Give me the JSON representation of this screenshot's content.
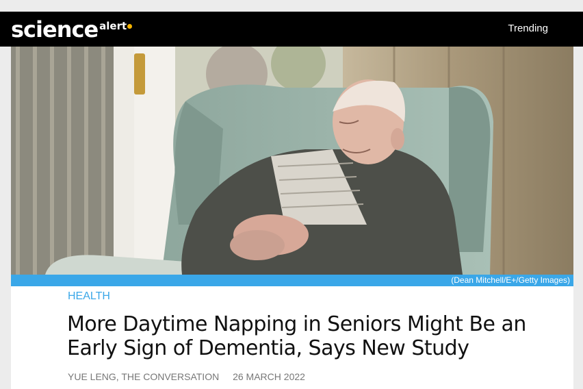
{
  "header": {
    "logo_main": "science",
    "logo_sub": "alert",
    "nav_trending": "Trending"
  },
  "hero": {
    "image_alt": "Elderly man napping in an armchair",
    "credit": "(Dean Mitchell/E+/Getty Images)"
  },
  "article": {
    "category": "HEALTH",
    "headline": "More Daytime Napping in Seniors Might Be an Early Sign of Dementia, Says New Study",
    "author": "YUE LENG, THE CONVERSATION",
    "date": "26 MARCH 2022"
  },
  "colors": {
    "header_bg": "#000000",
    "accent": "#3aa7e8",
    "logo_spark": "#f5b400"
  }
}
